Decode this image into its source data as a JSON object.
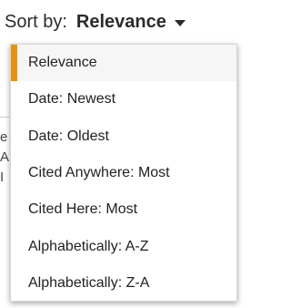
{
  "sort": {
    "label": "Sort by:",
    "current": "Relevance",
    "options": [
      "Relevance",
      "Date: Newest",
      "Date: Oldest",
      "Cited Anywhere: Most",
      "Cited Here: Most",
      "Alphabetically: A-Z",
      "Alphabetically: Z-A"
    ]
  },
  "background": {
    "fragments": [
      "e",
      "A",
      "I"
    ]
  },
  "colors": {
    "accent": "#e8910c",
    "text": "#222222"
  }
}
